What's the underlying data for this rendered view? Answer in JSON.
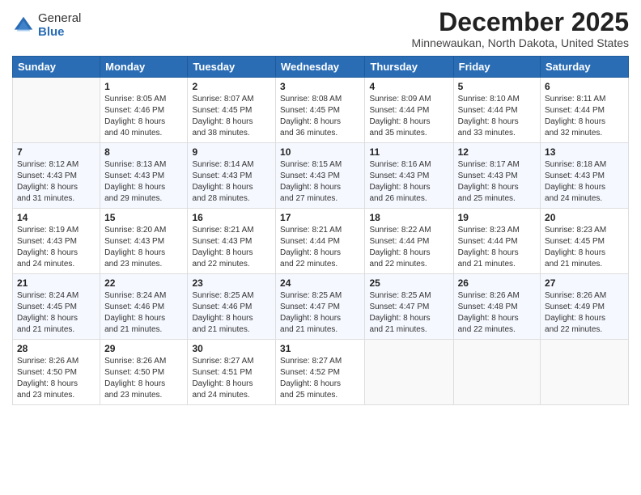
{
  "header": {
    "logo": {
      "general": "General",
      "blue": "Blue"
    },
    "title": "December 2025",
    "location": "Minnewaukan, North Dakota, United States"
  },
  "weekdays": [
    "Sunday",
    "Monday",
    "Tuesday",
    "Wednesday",
    "Thursday",
    "Friday",
    "Saturday"
  ],
  "weeks": [
    [
      {
        "day": "",
        "info": ""
      },
      {
        "day": "1",
        "info": "Sunrise: 8:05 AM\nSunset: 4:46 PM\nDaylight: 8 hours\nand 40 minutes."
      },
      {
        "day": "2",
        "info": "Sunrise: 8:07 AM\nSunset: 4:45 PM\nDaylight: 8 hours\nand 38 minutes."
      },
      {
        "day": "3",
        "info": "Sunrise: 8:08 AM\nSunset: 4:45 PM\nDaylight: 8 hours\nand 36 minutes."
      },
      {
        "day": "4",
        "info": "Sunrise: 8:09 AM\nSunset: 4:44 PM\nDaylight: 8 hours\nand 35 minutes."
      },
      {
        "day": "5",
        "info": "Sunrise: 8:10 AM\nSunset: 4:44 PM\nDaylight: 8 hours\nand 33 minutes."
      },
      {
        "day": "6",
        "info": "Sunrise: 8:11 AM\nSunset: 4:44 PM\nDaylight: 8 hours\nand 32 minutes."
      }
    ],
    [
      {
        "day": "7",
        "info": "Sunrise: 8:12 AM\nSunset: 4:43 PM\nDaylight: 8 hours\nand 31 minutes."
      },
      {
        "day": "8",
        "info": "Sunrise: 8:13 AM\nSunset: 4:43 PM\nDaylight: 8 hours\nand 29 minutes."
      },
      {
        "day": "9",
        "info": "Sunrise: 8:14 AM\nSunset: 4:43 PM\nDaylight: 8 hours\nand 28 minutes."
      },
      {
        "day": "10",
        "info": "Sunrise: 8:15 AM\nSunset: 4:43 PM\nDaylight: 8 hours\nand 27 minutes."
      },
      {
        "day": "11",
        "info": "Sunrise: 8:16 AM\nSunset: 4:43 PM\nDaylight: 8 hours\nand 26 minutes."
      },
      {
        "day": "12",
        "info": "Sunrise: 8:17 AM\nSunset: 4:43 PM\nDaylight: 8 hours\nand 25 minutes."
      },
      {
        "day": "13",
        "info": "Sunrise: 8:18 AM\nSunset: 4:43 PM\nDaylight: 8 hours\nand 24 minutes."
      }
    ],
    [
      {
        "day": "14",
        "info": "Sunrise: 8:19 AM\nSunset: 4:43 PM\nDaylight: 8 hours\nand 24 minutes."
      },
      {
        "day": "15",
        "info": "Sunrise: 8:20 AM\nSunset: 4:43 PM\nDaylight: 8 hours\nand 23 minutes."
      },
      {
        "day": "16",
        "info": "Sunrise: 8:21 AM\nSunset: 4:43 PM\nDaylight: 8 hours\nand 22 minutes."
      },
      {
        "day": "17",
        "info": "Sunrise: 8:21 AM\nSunset: 4:44 PM\nDaylight: 8 hours\nand 22 minutes."
      },
      {
        "day": "18",
        "info": "Sunrise: 8:22 AM\nSunset: 4:44 PM\nDaylight: 8 hours\nand 22 minutes."
      },
      {
        "day": "19",
        "info": "Sunrise: 8:23 AM\nSunset: 4:44 PM\nDaylight: 8 hours\nand 21 minutes."
      },
      {
        "day": "20",
        "info": "Sunrise: 8:23 AM\nSunset: 4:45 PM\nDaylight: 8 hours\nand 21 minutes."
      }
    ],
    [
      {
        "day": "21",
        "info": "Sunrise: 8:24 AM\nSunset: 4:45 PM\nDaylight: 8 hours\nand 21 minutes."
      },
      {
        "day": "22",
        "info": "Sunrise: 8:24 AM\nSunset: 4:46 PM\nDaylight: 8 hours\nand 21 minutes."
      },
      {
        "day": "23",
        "info": "Sunrise: 8:25 AM\nSunset: 4:46 PM\nDaylight: 8 hours\nand 21 minutes."
      },
      {
        "day": "24",
        "info": "Sunrise: 8:25 AM\nSunset: 4:47 PM\nDaylight: 8 hours\nand 21 minutes."
      },
      {
        "day": "25",
        "info": "Sunrise: 8:25 AM\nSunset: 4:47 PM\nDaylight: 8 hours\nand 21 minutes."
      },
      {
        "day": "26",
        "info": "Sunrise: 8:26 AM\nSunset: 4:48 PM\nDaylight: 8 hours\nand 22 minutes."
      },
      {
        "day": "27",
        "info": "Sunrise: 8:26 AM\nSunset: 4:49 PM\nDaylight: 8 hours\nand 22 minutes."
      }
    ],
    [
      {
        "day": "28",
        "info": "Sunrise: 8:26 AM\nSunset: 4:50 PM\nDaylight: 8 hours\nand 23 minutes."
      },
      {
        "day": "29",
        "info": "Sunrise: 8:26 AM\nSunset: 4:50 PM\nDaylight: 8 hours\nand 23 minutes."
      },
      {
        "day": "30",
        "info": "Sunrise: 8:27 AM\nSunset: 4:51 PM\nDaylight: 8 hours\nand 24 minutes."
      },
      {
        "day": "31",
        "info": "Sunrise: 8:27 AM\nSunset: 4:52 PM\nDaylight: 8 hours\nand 25 minutes."
      },
      {
        "day": "",
        "info": ""
      },
      {
        "day": "",
        "info": ""
      },
      {
        "day": "",
        "info": ""
      }
    ]
  ]
}
